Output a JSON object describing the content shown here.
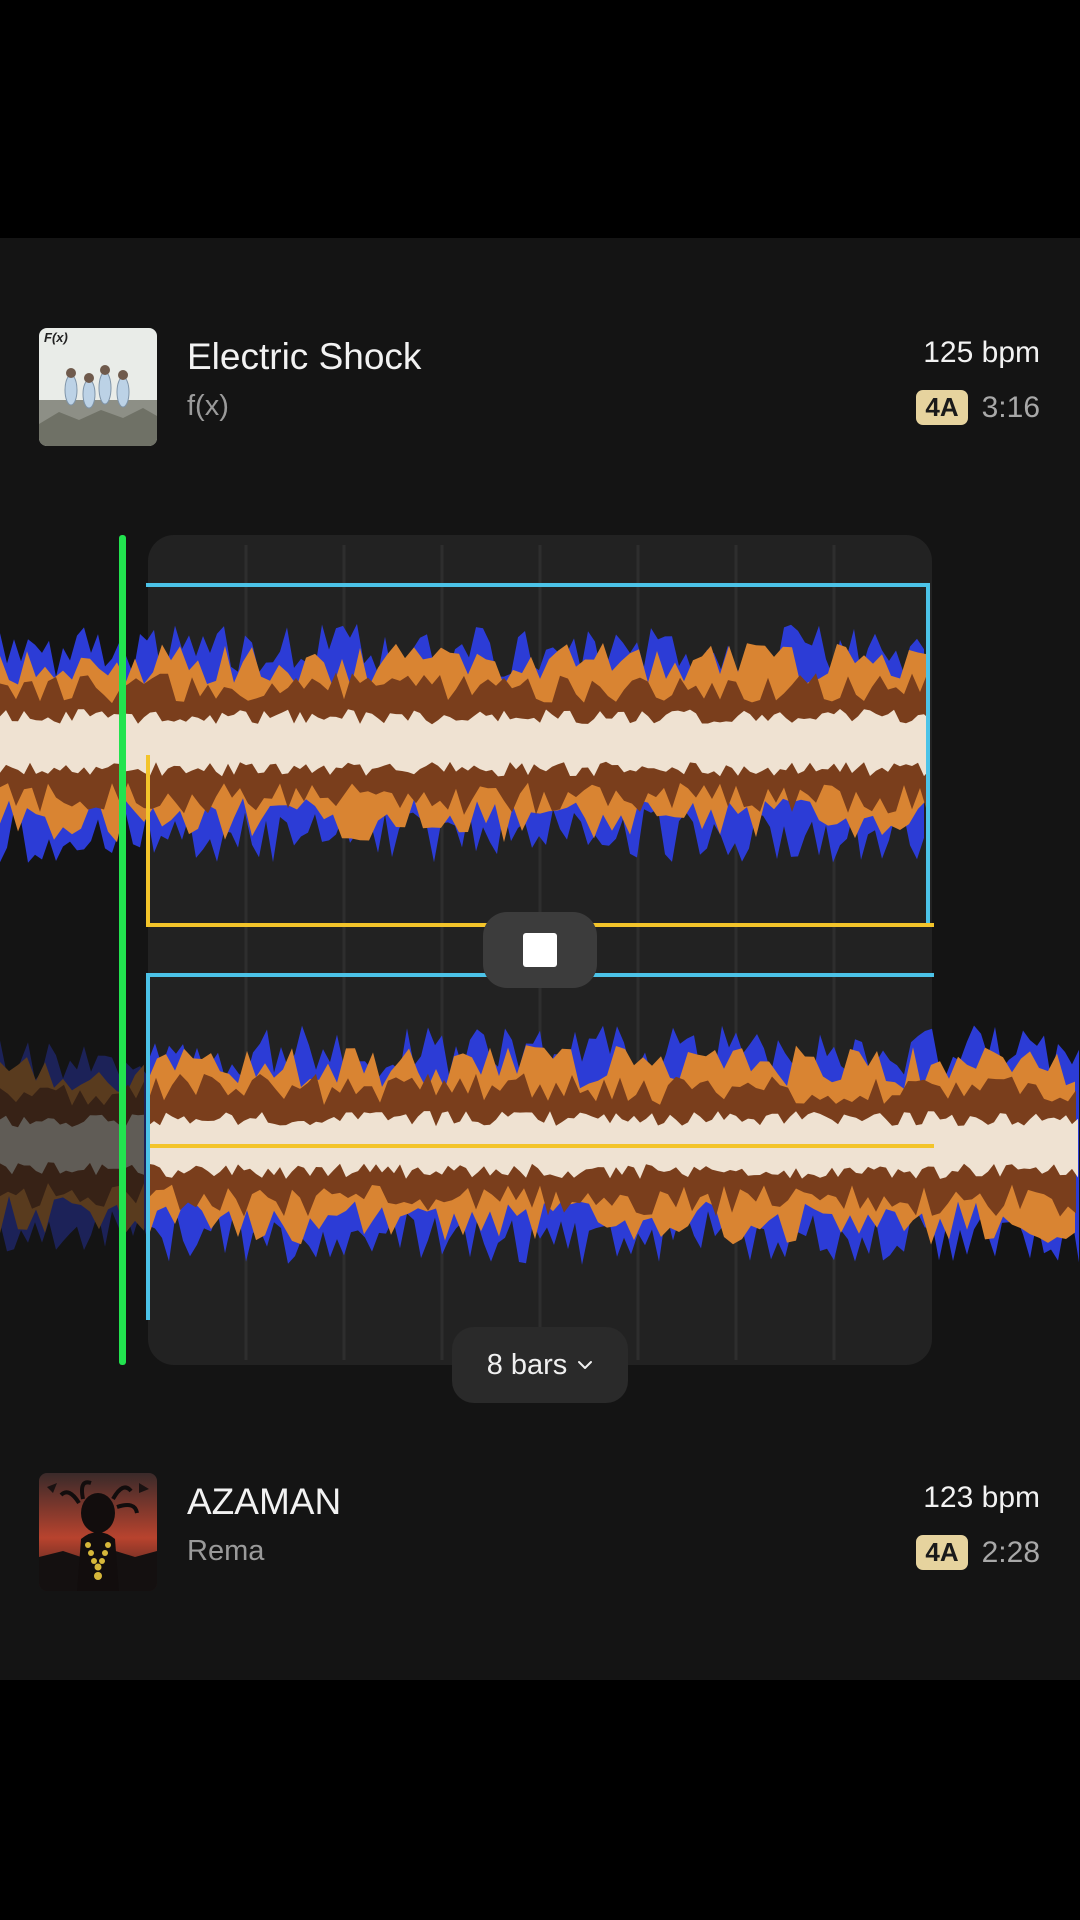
{
  "track_top": {
    "title": "Electric Shock",
    "artist": "f(x)",
    "bpm": "125 bpm",
    "key": "4A",
    "duration": "3:16",
    "art_text": "F(x)"
  },
  "track_bottom": {
    "title": "AZAMAN",
    "artist": "Rema",
    "bpm": "123 bpm",
    "key": "4A",
    "duration": "2:28"
  },
  "controls": {
    "bars_label": "8 bars",
    "stop_icon": "stop-icon",
    "dropdown_icon": "chevron-down-icon"
  },
  "colors": {
    "playhead": "#22e34f",
    "loop_region": "#4cc3e8",
    "marker": "#f3c42a",
    "wave_outer": "#2c3cd6",
    "wave_mid": "#d98432",
    "wave_inner": "#7a3e1c",
    "wave_core": "#efe2d2"
  }
}
